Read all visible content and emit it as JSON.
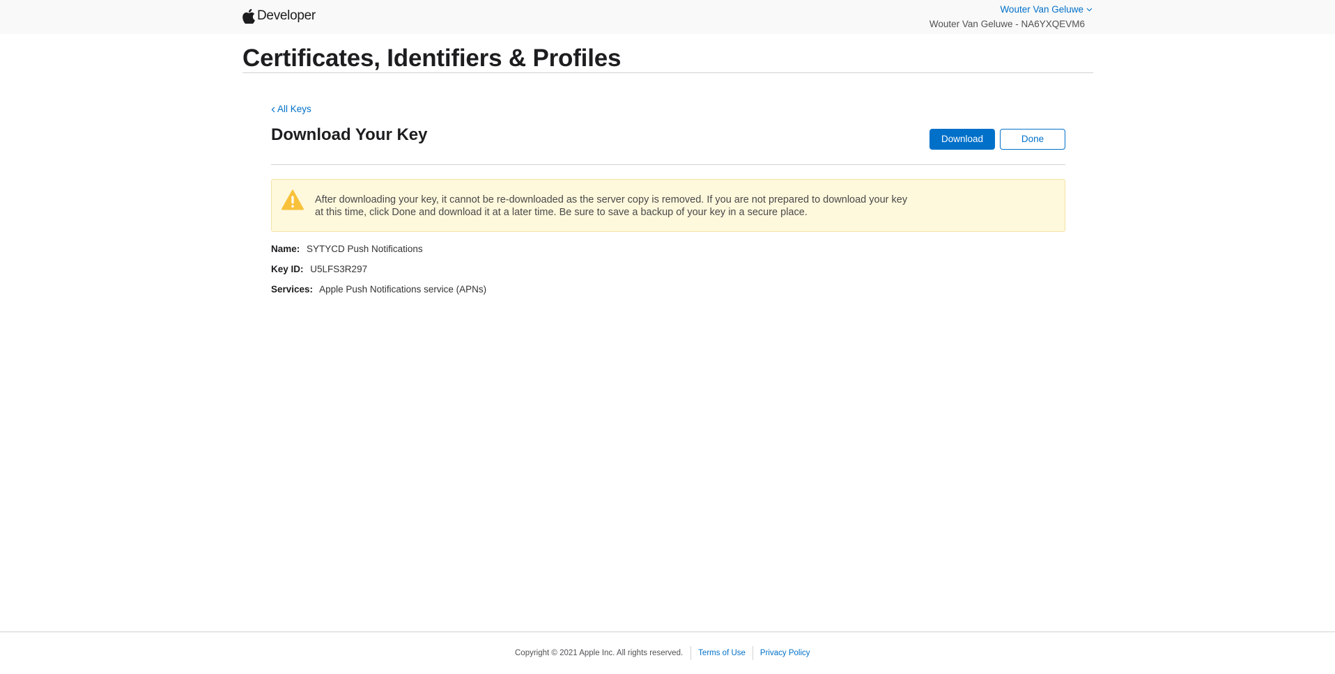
{
  "header": {
    "brand": "Developer",
    "account_name": "Wouter Van Geluwe",
    "team_label": "Wouter Van Geluwe - NA6YXQEVM6"
  },
  "page": {
    "title": "Certificates, Identifiers & Profiles"
  },
  "content": {
    "back_link": "All Keys",
    "section_title": "Download Your Key",
    "download_button": "Download",
    "done_button": "Done",
    "alert_text": "After downloading your key, it cannot be re-downloaded as the server copy is removed. If you are not prepared to download your key at this time, click Done and download it at a later time. Be sure to save a backup of your key in a secure place.",
    "details": [
      {
        "label": "Name:",
        "value": "SYTYCD Push Notifications"
      },
      {
        "label": "Key ID:",
        "value": "U5LFS3R297"
      },
      {
        "label": "Services:",
        "value": "Apple Push Notifications service (APNs)"
      }
    ]
  },
  "footer": {
    "copyright": "Copyright © 2021 Apple Inc. All rights reserved.",
    "terms": "Terms of Use",
    "privacy": "Privacy Policy"
  },
  "icons": {
    "brand_logo": "apple-logo-icon",
    "account_chevron": "chevron-down-icon",
    "back_chevron": "chevron-left-icon",
    "alert": "warning-icon"
  },
  "colors": {
    "link": "#0070c9",
    "alert_bg": "#fef8dc",
    "warning": "#f8c13a"
  }
}
